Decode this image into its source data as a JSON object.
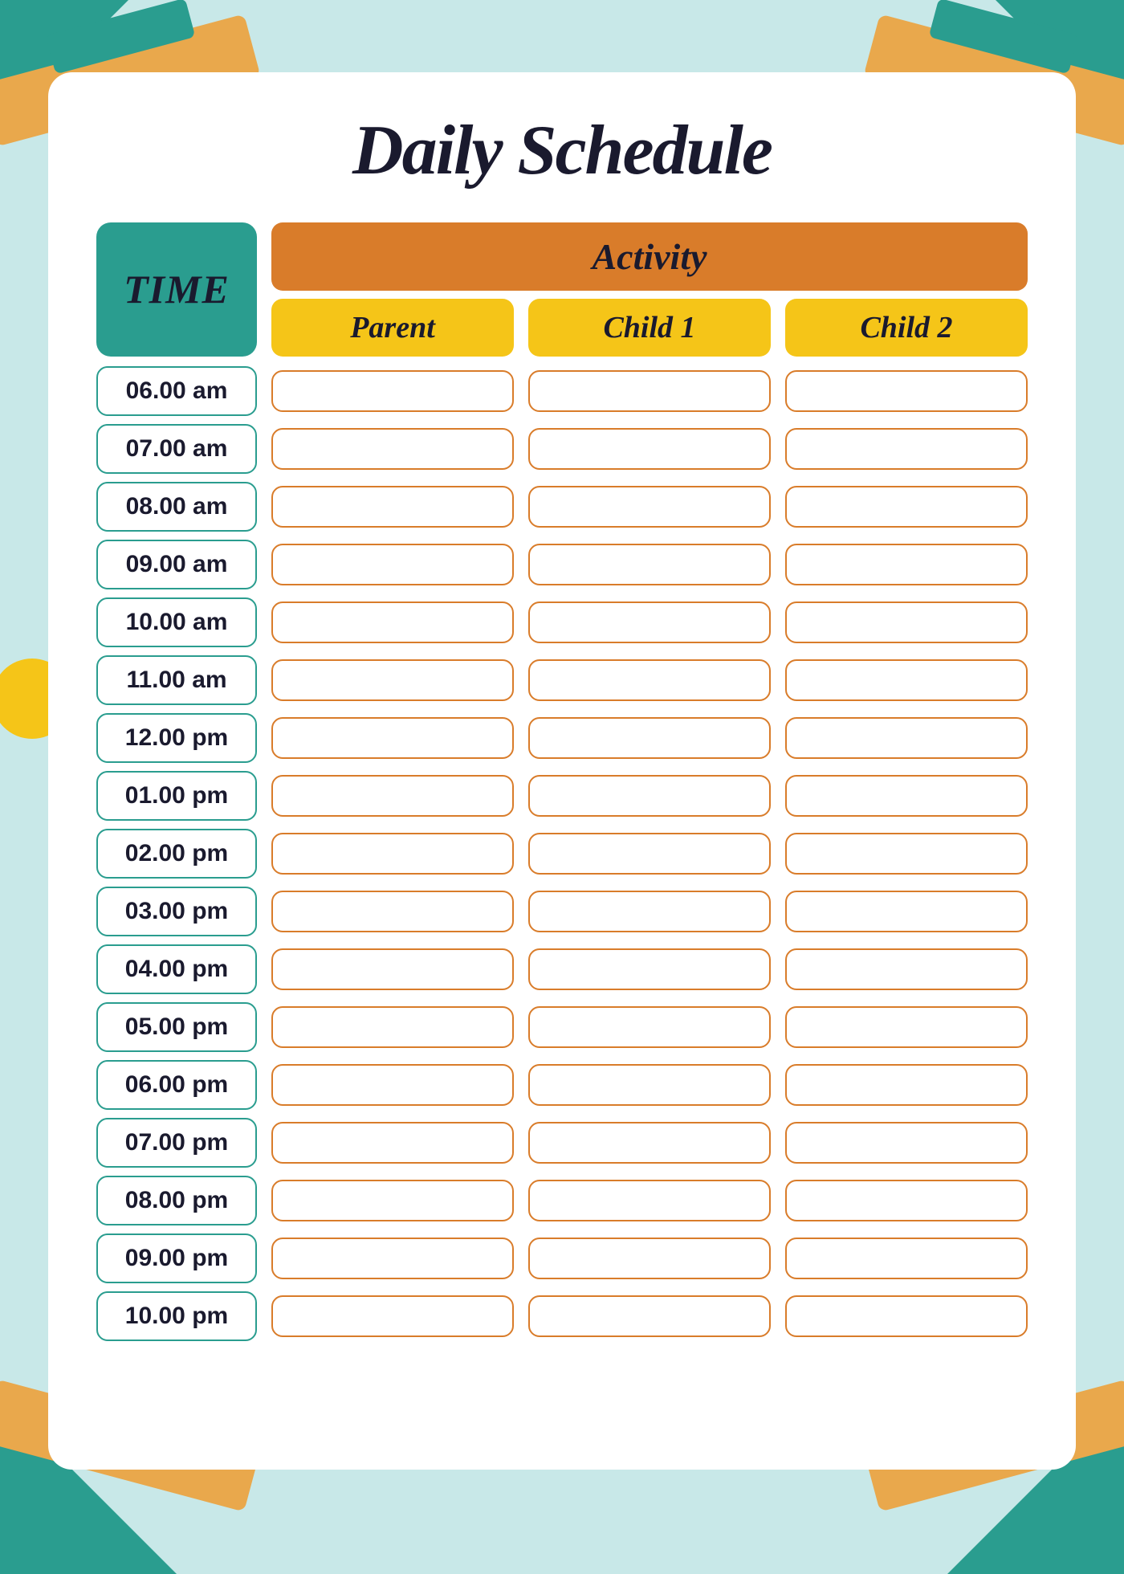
{
  "title": "Daily Schedule",
  "header": {
    "time_label": "TIME",
    "activity_label": "Activity",
    "columns": [
      "Parent",
      "Child 1",
      "Child 2"
    ]
  },
  "time_slots": [
    "06.00 am",
    "07.00 am",
    "08.00 am",
    "09.00 am",
    "10.00 am",
    "11.00 am",
    "12.00 pm",
    "01.00 pm",
    "02.00 pm",
    "03.00 pm",
    "04.00 pm",
    "05.00 pm",
    "06.00 pm",
    "07.00 pm",
    "08.00 pm",
    "09.00 pm",
    "10.00 pm"
  ],
  "colors": {
    "teal": "#2a9d8f",
    "orange": "#d97c2a",
    "yellow": "#f5c518",
    "dark": "#1a1a2e",
    "background": "#c8e8e8",
    "card": "#ffffff"
  }
}
